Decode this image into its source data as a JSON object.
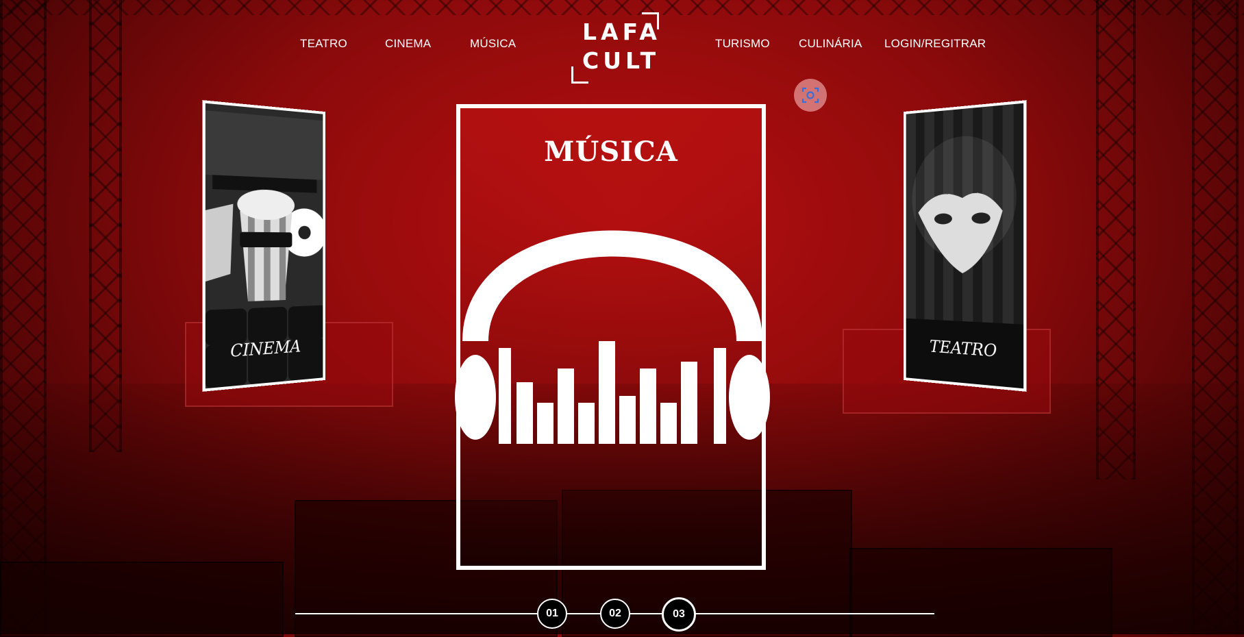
{
  "nav": {
    "left": [
      "TEATRO",
      "CINEMA",
      "MÚSICA"
    ],
    "right": [
      "TURISMO",
      "CULINÁRIA",
      "LOGIN/REGITRAR"
    ]
  },
  "logo": {
    "line1": "LAFA",
    "line2": "CULT"
  },
  "cards": {
    "left_label": "CINEMA",
    "main_title": "MÚSICA",
    "right_label": "TEATRO"
  },
  "pager": {
    "pages": [
      "01",
      "02",
      "03"
    ],
    "active": "03"
  },
  "icons": {
    "screenshot": "screenshot-capture-icon"
  },
  "colors": {
    "accent": "#b80f10",
    "white": "#ffffff"
  }
}
